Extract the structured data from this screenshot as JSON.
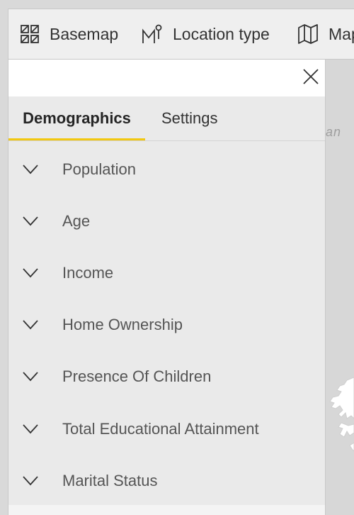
{
  "toolbar": {
    "basemap_label": "Basemap",
    "location_type_label": "Location type",
    "map_tools_label": "Map tools"
  },
  "map": {
    "fragment_text": "an"
  },
  "panel": {
    "tabs": [
      {
        "label": "Demographics",
        "active": true
      },
      {
        "label": "Settings",
        "active": false
      }
    ],
    "items": [
      {
        "label": "Population"
      },
      {
        "label": "Age"
      },
      {
        "label": "Income"
      },
      {
        "label": "Home Ownership"
      },
      {
        "label": "Presence Of Children"
      },
      {
        "label": "Total Educational Attainment"
      },
      {
        "label": "Marital Status"
      }
    ]
  },
  "colors": {
    "accent": "#f2c811",
    "panel_bg": "#eaeaea",
    "header_bg": "#ffffff",
    "toolbar_bg": "#efefef"
  },
  "icons": {
    "basemap": "basemap-grid-icon",
    "location_type": "location-pin-icon",
    "map_tools": "map-icon",
    "close": "close-icon",
    "expand": "chevron-down-icon"
  }
}
